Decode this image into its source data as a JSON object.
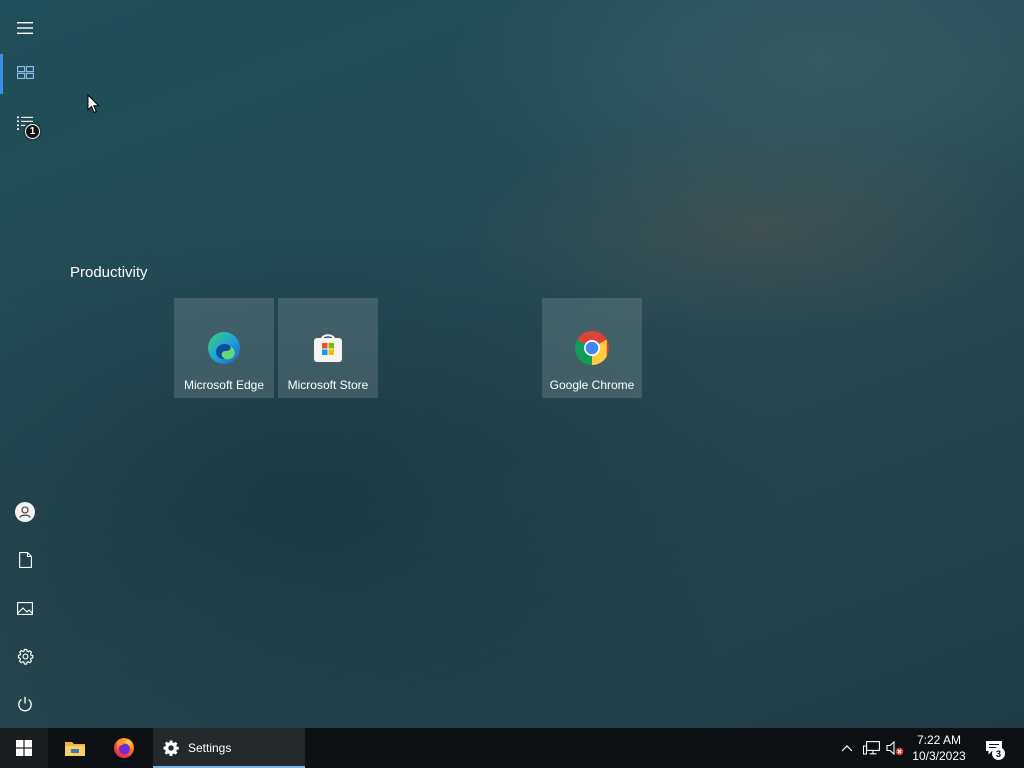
{
  "start_menu": {
    "group_title": "Productivity",
    "tiles": [
      {
        "label": "Microsoft Edge",
        "icon": "edge-icon"
      },
      {
        "label": "Microsoft Store",
        "icon": "store-icon"
      },
      {
        "label": "Google Chrome",
        "icon": "chrome-icon"
      }
    ],
    "rail": {
      "items": [
        {
          "name": "menu",
          "icon": "hamburger-icon"
        },
        {
          "name": "all-tiles",
          "icon": "tiles-icon",
          "active": true
        },
        {
          "name": "all-apps",
          "icon": "list-icon",
          "badge": "1"
        },
        {
          "name": "account",
          "icon": "user-icon"
        },
        {
          "name": "documents",
          "icon": "document-icon"
        },
        {
          "name": "pictures",
          "icon": "pictures-icon"
        },
        {
          "name": "settings",
          "icon": "gear-icon"
        },
        {
          "name": "power",
          "icon": "power-icon"
        }
      ]
    }
  },
  "taskbar": {
    "start_icon": "windows-icon",
    "apps": [
      {
        "name": "file-explorer",
        "icon": "folder-icon"
      },
      {
        "name": "firefox",
        "icon": "firefox-icon"
      },
      {
        "name": "settings",
        "icon": "gear-icon",
        "label": "Settings",
        "active": true
      }
    ],
    "tray": {
      "time": "7:22 AM",
      "date": "10/3/2023",
      "notification_count": "3"
    }
  },
  "colors": {
    "accent": "#3a8ee6",
    "taskbar": "#0d1012",
    "tile": "#ffffff24"
  }
}
